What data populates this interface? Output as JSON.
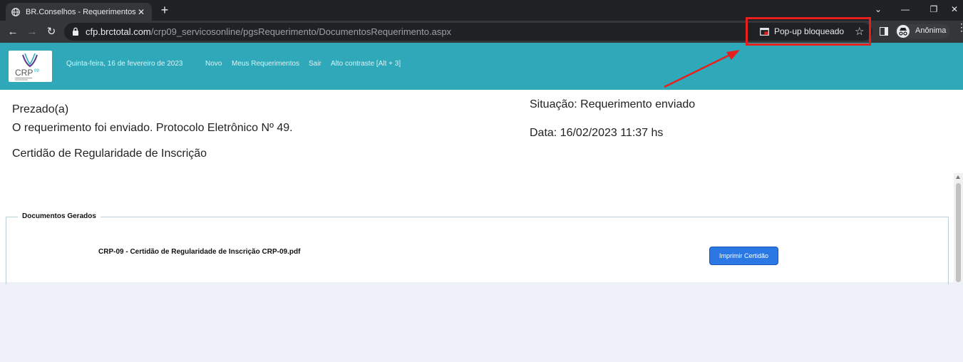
{
  "browser": {
    "tab_title": "BR.Conselhos - Requerimentos O",
    "tab_close": "✕",
    "new_tab": "+",
    "url_domain": "cfp.brctotal.com",
    "url_path": "/crp09_servicosonline/pgsRequerimento/DocumentosRequerimento.aspx",
    "popup_blocked": "Pop-up bloqueado",
    "profile_label": "Anônima",
    "window_controls": {
      "collapse": "⌄",
      "minimize": "—",
      "restore": "❐",
      "close": "✕"
    },
    "nav": {
      "back": "←",
      "forward": "→",
      "reload": "↻"
    },
    "star": "☆"
  },
  "header": {
    "logo_text": "CRP",
    "logo_superscript": "09",
    "date": "Quinta-feira, 16 de fevereiro de 2023",
    "nav": [
      {
        "label": "Novo"
      },
      {
        "label": "Meus Requerimentos"
      },
      {
        "label": "Sair"
      },
      {
        "label": "Alto contraste [Alt + 3]"
      }
    ]
  },
  "content": {
    "greeting": "Prezado(a)",
    "message": "O requerimento foi enviado. Protocolo Eletrônico Nº 49.",
    "request_type": "Certidão de Regularidade de Inscrição",
    "status": "Situação: Requerimento enviado",
    "date": "Data: 16/02/2023 11:37 hs"
  },
  "documents": {
    "legend": "Documentos Gerados",
    "file_name": "CRP-09 - Certidão de Regularidade de Inscrição CRP-09.pdf",
    "print_button": "Imprimir Certidão"
  },
  "colors": {
    "header_bg": "#2fa8b9",
    "annotation_red": "#e8201d",
    "button_blue": "#2b78e4"
  }
}
